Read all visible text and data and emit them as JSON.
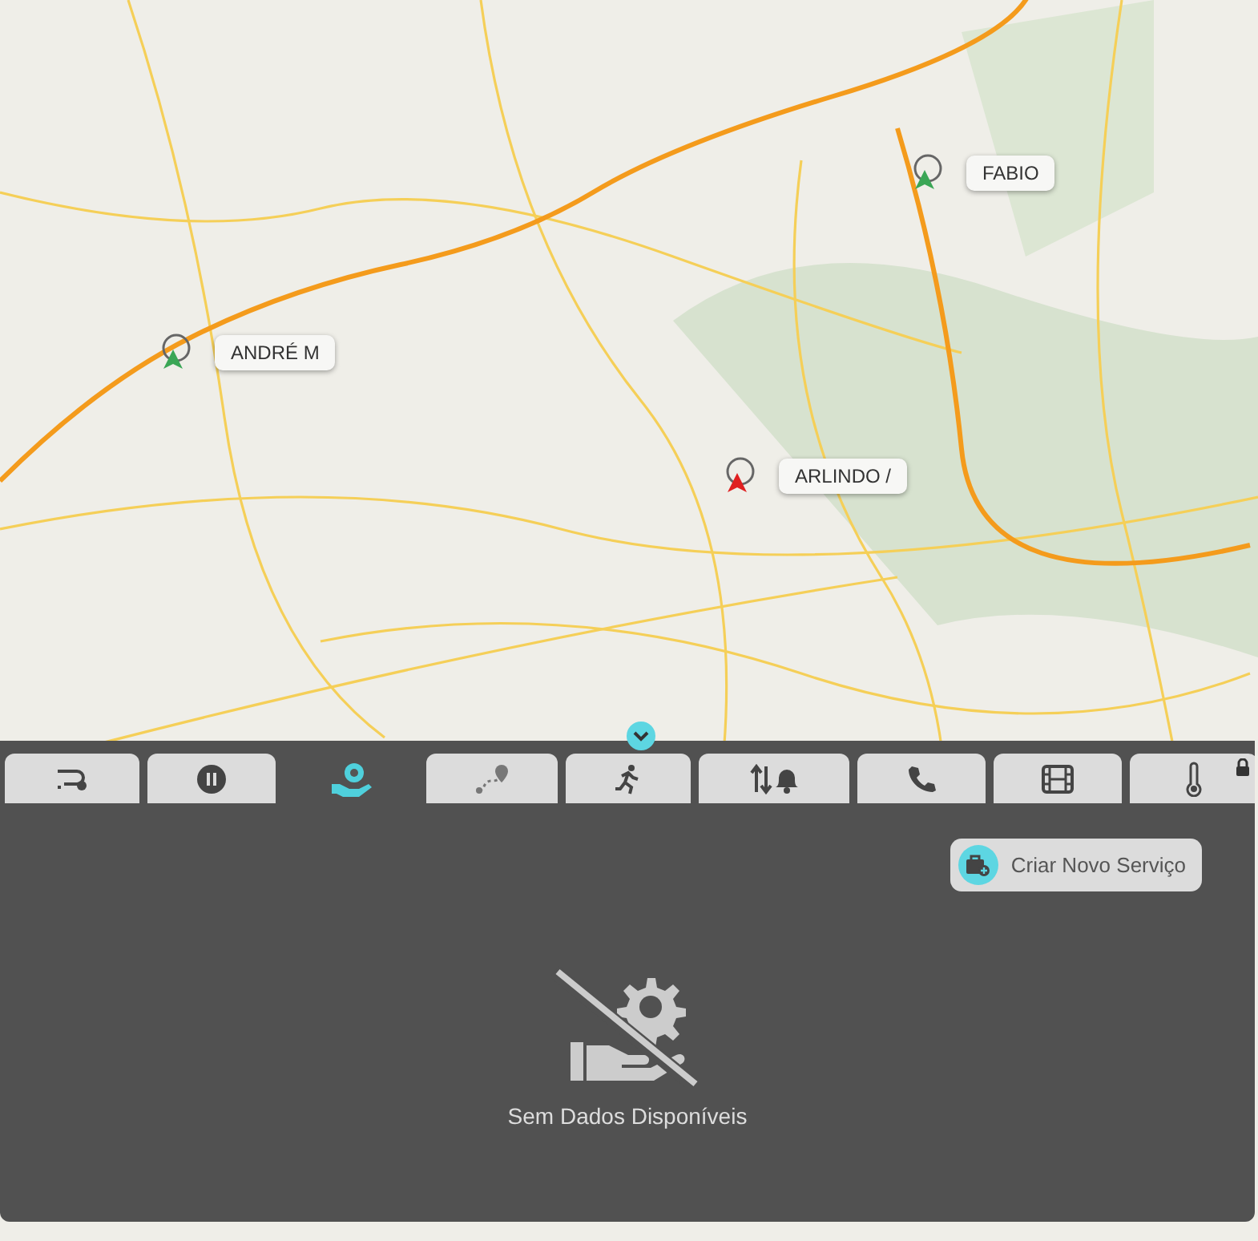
{
  "map": {
    "markers": [
      {
        "label": "ANDRÉ M",
        "color": "#3aa655"
      },
      {
        "label": "FABIO",
        "color": "#3aa655"
      },
      {
        "label": "ARLINDO /",
        "color": "#e02020"
      }
    ]
  },
  "panel": {
    "expanded": true,
    "tabs": [
      {
        "kind": "route",
        "selected": false,
        "locked": false
      },
      {
        "kind": "pause",
        "selected": false,
        "locked": false
      },
      {
        "kind": "service",
        "selected": true,
        "locked": false
      },
      {
        "kind": "track",
        "selected": false,
        "locked": false
      },
      {
        "kind": "run",
        "selected": false,
        "locked": false
      },
      {
        "kind": "alerts",
        "selected": false,
        "locked": false
      },
      {
        "kind": "phone",
        "selected": false,
        "locked": false
      },
      {
        "kind": "film",
        "selected": false,
        "locked": false
      },
      {
        "kind": "temperature",
        "selected": false,
        "locked": true
      }
    ],
    "new_service_button": "Criar Novo Serviço",
    "empty_message": "Sem Dados Disponíveis"
  }
}
